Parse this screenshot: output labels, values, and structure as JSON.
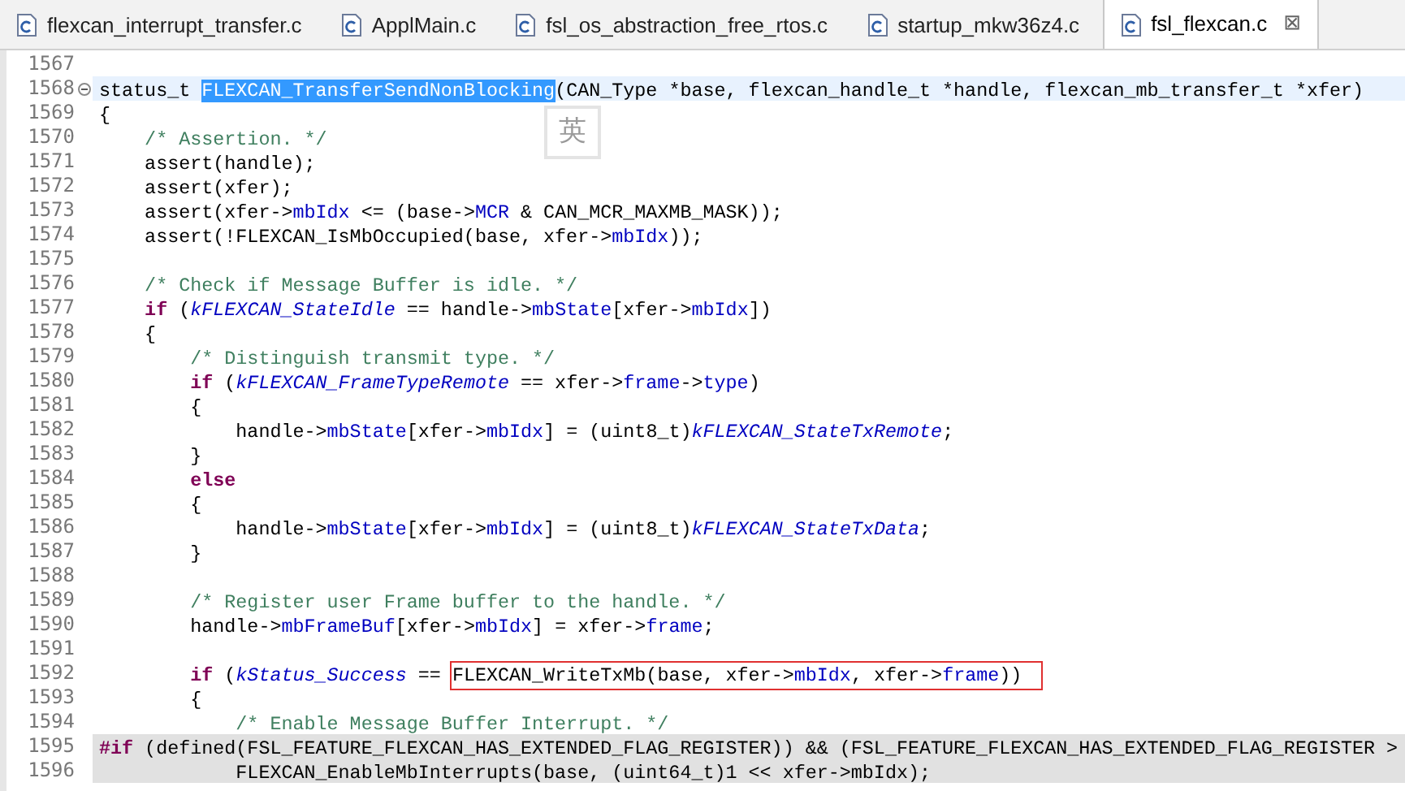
{
  "tabs": [
    {
      "label": "flexcan_interrupt_transfer.c",
      "selected": false
    },
    {
      "label": "ApplMain.c",
      "selected": false
    },
    {
      "label": "fsl_os_abstraction_free_rtos.c",
      "selected": false
    },
    {
      "label": "startup_mkw36z4.c",
      "selected": false
    },
    {
      "label": "fsl_flexcan.c",
      "selected": true,
      "close": "⊠"
    }
  ],
  "ime_indicator": "英",
  "lines": [
    {
      "number": "1567",
      "current": false,
      "inactive": false,
      "collapsible": false
    },
    {
      "number": "1568",
      "current": true,
      "inactive": false,
      "collapsible": true,
      "tokens": [
        {
          "kind": "plain",
          "text": "status_t "
        },
        {
          "kind": "selected",
          "text": "FLEXCAN_TransferSendNonBlocking"
        },
        {
          "kind": "plain",
          "text": "(CAN_Type *base, flexcan_handle_t *handle, flexcan_mb_transfer_t *xfer)"
        }
      ]
    },
    {
      "number": "1569",
      "current": false,
      "inactive": false,
      "collapsible": false,
      "tokens": [
        {
          "kind": "plain",
          "text": "{"
        }
      ]
    },
    {
      "number": "1570",
      "current": false,
      "inactive": false,
      "collapsible": false,
      "tokens": [
        {
          "kind": "comment",
          "text": "    /* Assertion. */"
        }
      ]
    },
    {
      "number": "1571",
      "current": false,
      "inactive": false,
      "collapsible": false,
      "tokens": [
        {
          "kind": "plain",
          "text": "    assert(handle);"
        }
      ]
    },
    {
      "number": "1572",
      "current": false,
      "inactive": false,
      "collapsible": false,
      "tokens": [
        {
          "kind": "plain",
          "text": "    assert(xfer);"
        }
      ]
    },
    {
      "number": "1573",
      "current": false,
      "inactive": false,
      "collapsible": false,
      "tokens": [
        {
          "kind": "plain",
          "text": "    assert(xfer->"
        },
        {
          "kind": "field",
          "text": "mbIdx"
        },
        {
          "kind": "plain",
          "text": " <= (base->"
        },
        {
          "kind": "field",
          "text": "MCR"
        },
        {
          "kind": "plain",
          "text": " & CAN_MCR_MAXMB_MASK));"
        }
      ]
    },
    {
      "number": "1574",
      "current": false,
      "inactive": false,
      "collapsible": false,
      "tokens": [
        {
          "kind": "plain",
          "text": "    assert(!FLEXCAN_IsMbOccupied(base, xfer->"
        },
        {
          "kind": "field",
          "text": "mbIdx"
        },
        {
          "kind": "plain",
          "text": "));"
        }
      ]
    },
    {
      "number": "1575",
      "current": false,
      "inactive": false,
      "collapsible": false
    },
    {
      "number": "1576",
      "current": false,
      "inactive": false,
      "collapsible": false,
      "tokens": [
        {
          "kind": "comment",
          "text": "    /* Check if Message Buffer is idle. */"
        }
      ]
    },
    {
      "number": "1577",
      "current": false,
      "inactive": false,
      "collapsible": false,
      "tokens": [
        {
          "kind": "keyword",
          "text": "    if"
        },
        {
          "kind": "plain",
          "text": " ("
        },
        {
          "kind": "constant",
          "text": "kFLEXCAN_StateIdle"
        },
        {
          "kind": "plain",
          "text": " == handle->"
        },
        {
          "kind": "field",
          "text": "mbState"
        },
        {
          "kind": "plain",
          "text": "[xfer->"
        },
        {
          "kind": "field",
          "text": "mbIdx"
        },
        {
          "kind": "plain",
          "text": "])"
        }
      ]
    },
    {
      "number": "1578",
      "current": false,
      "inactive": false,
      "collapsible": false,
      "tokens": [
        {
          "kind": "plain",
          "text": "    {"
        }
      ]
    },
    {
      "number": "1579",
      "current": false,
      "inactive": false,
      "collapsible": false,
      "tokens": [
        {
          "kind": "comment",
          "text": "        /* Distinguish transmit type. */"
        }
      ]
    },
    {
      "number": "1580",
      "current": false,
      "inactive": false,
      "collapsible": false,
      "tokens": [
        {
          "kind": "keyword",
          "text": "        if"
        },
        {
          "kind": "plain",
          "text": " ("
        },
        {
          "kind": "constant",
          "text": "kFLEXCAN_FrameTypeRemote"
        },
        {
          "kind": "plain",
          "text": " == xfer->"
        },
        {
          "kind": "field",
          "text": "frame"
        },
        {
          "kind": "plain",
          "text": "->"
        },
        {
          "kind": "field",
          "text": "type"
        },
        {
          "kind": "plain",
          "text": ")"
        }
      ]
    },
    {
      "number": "1581",
      "current": false,
      "inactive": false,
      "collapsible": false,
      "tokens": [
        {
          "kind": "plain",
          "text": "        {"
        }
      ]
    },
    {
      "number": "1582",
      "current": false,
      "inactive": false,
      "collapsible": false,
      "tokens": [
        {
          "kind": "plain",
          "text": "            handle->"
        },
        {
          "kind": "field",
          "text": "mbState"
        },
        {
          "kind": "plain",
          "text": "[xfer->"
        },
        {
          "kind": "field",
          "text": "mbIdx"
        },
        {
          "kind": "plain",
          "text": "] = (uint8_t)"
        },
        {
          "kind": "constant",
          "text": "kFLEXCAN_StateTxRemote"
        },
        {
          "kind": "plain",
          "text": ";"
        }
      ]
    },
    {
      "number": "1583",
      "current": false,
      "inactive": false,
      "collapsible": false,
      "tokens": [
        {
          "kind": "plain",
          "text": "        }"
        }
      ]
    },
    {
      "number": "1584",
      "current": false,
      "inactive": false,
      "collapsible": false,
      "tokens": [
        {
          "kind": "keyword",
          "text": "        else"
        }
      ]
    },
    {
      "number": "1585",
      "current": false,
      "inactive": false,
      "collapsible": false,
      "tokens": [
        {
          "kind": "plain",
          "text": "        {"
        }
      ]
    },
    {
      "number": "1586",
      "current": false,
      "inactive": false,
      "collapsible": false,
      "tokens": [
        {
          "kind": "plain",
          "text": "            handle->"
        },
        {
          "kind": "field",
          "text": "mbState"
        },
        {
          "kind": "plain",
          "text": "[xfer->"
        },
        {
          "kind": "field",
          "text": "mbIdx"
        },
        {
          "kind": "plain",
          "text": "] = (uint8_t)"
        },
        {
          "kind": "constant",
          "text": "kFLEXCAN_StateTxData"
        },
        {
          "kind": "plain",
          "text": ";"
        }
      ]
    },
    {
      "number": "1587",
      "current": false,
      "inactive": false,
      "collapsible": false,
      "tokens": [
        {
          "kind": "plain",
          "text": "        }"
        }
      ]
    },
    {
      "number": "1588",
      "current": false,
      "inactive": false,
      "collapsible": false
    },
    {
      "number": "1589",
      "current": false,
      "inactive": false,
      "collapsible": false,
      "tokens": [
        {
          "kind": "comment",
          "text": "        /* Register user Frame buffer to the handle. */"
        }
      ]
    },
    {
      "number": "1590",
      "current": false,
      "inactive": false,
      "collapsible": false,
      "tokens": [
        {
          "kind": "plain",
          "text": "        handle->"
        },
        {
          "kind": "field",
          "text": "mbFrameBuf"
        },
        {
          "kind": "plain",
          "text": "[xfer->"
        },
        {
          "kind": "field",
          "text": "mbIdx"
        },
        {
          "kind": "plain",
          "text": "] = xfer->"
        },
        {
          "kind": "field",
          "text": "frame"
        },
        {
          "kind": "plain",
          "text": ";"
        }
      ]
    },
    {
      "number": "1591",
      "current": false,
      "inactive": false,
      "collapsible": false
    },
    {
      "number": "1592",
      "current": false,
      "inactive": false,
      "collapsible": false,
      "tokens": [
        {
          "kind": "keyword",
          "text": "        if"
        },
        {
          "kind": "plain",
          "text": " ("
        },
        {
          "kind": "constant",
          "text": "kStatus_Success"
        },
        {
          "kind": "plain",
          "text": " == "
        },
        {
          "kind": "boxed",
          "tokens": [
            {
              "kind": "plain",
              "text": "FLEXCAN_WriteTxMb(base, xfer->"
            },
            {
              "kind": "field",
              "text": "mbIdx"
            },
            {
              "kind": "plain",
              "text": ", xfer->"
            },
            {
              "kind": "field",
              "text": "frame"
            },
            {
              "kind": "plain",
              "text": "))"
            }
          ]
        }
      ]
    },
    {
      "number": "1593",
      "current": false,
      "inactive": false,
      "collapsible": false,
      "tokens": [
        {
          "kind": "plain",
          "text": "        {"
        }
      ]
    },
    {
      "number": "1594",
      "current": false,
      "inactive": false,
      "collapsible": false,
      "tokens": [
        {
          "kind": "comment",
          "text": "            /* Enable Message Buffer Interrupt. */"
        }
      ]
    },
    {
      "number": "1595",
      "current": false,
      "inactive": true,
      "collapsible": false,
      "tokens": [
        {
          "kind": "keyword",
          "text": "#if"
        },
        {
          "kind": "plain",
          "text": " (defined(FSL_FEATURE_FLEXCAN_HAS_EXTENDED_FLAG_REGISTER)) && (FSL_FEATURE_FLEXCAN_HAS_EXTENDED_FLAG_REGISTER >"
        }
      ]
    },
    {
      "number": "1596",
      "current": false,
      "inactive": true,
      "collapsible": false,
      "tokens": [
        {
          "kind": "plain",
          "text": "            FLEXCAN_EnableMbInterrupts(base, (uint64_t)1 << xfer->mbIdx);"
        }
      ]
    }
  ]
}
